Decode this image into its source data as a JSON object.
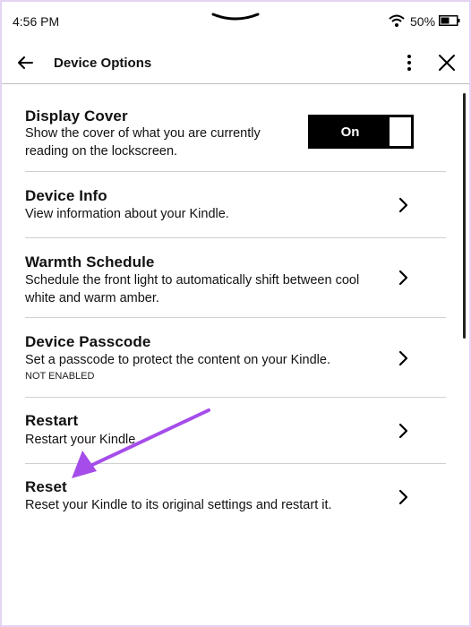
{
  "status": {
    "time": "4:56 PM",
    "battery": "50%"
  },
  "header": {
    "title": "Device Options"
  },
  "settings": {
    "display_cover": {
      "title": "Display Cover",
      "description": "Show the cover of what you are currently reading on the lockscreen.",
      "toggle_label": "On"
    },
    "device_info": {
      "title": "Device Info",
      "description": "View information about your Kindle."
    },
    "warmth_schedule": {
      "title": "Warmth Schedule",
      "description": "Schedule the front light to automatically shift between cool white and warm amber."
    },
    "device_passcode": {
      "title": "Device Passcode",
      "description": "Set a passcode to protect the content on your Kindle.",
      "status": "NOT ENABLED"
    },
    "restart": {
      "title": "Restart",
      "description": "Restart your Kindle."
    },
    "reset": {
      "title": "Reset",
      "description": "Reset your Kindle to its original settings and restart it."
    }
  },
  "icons": {
    "annotation_arrow_color": "#a54dea"
  }
}
